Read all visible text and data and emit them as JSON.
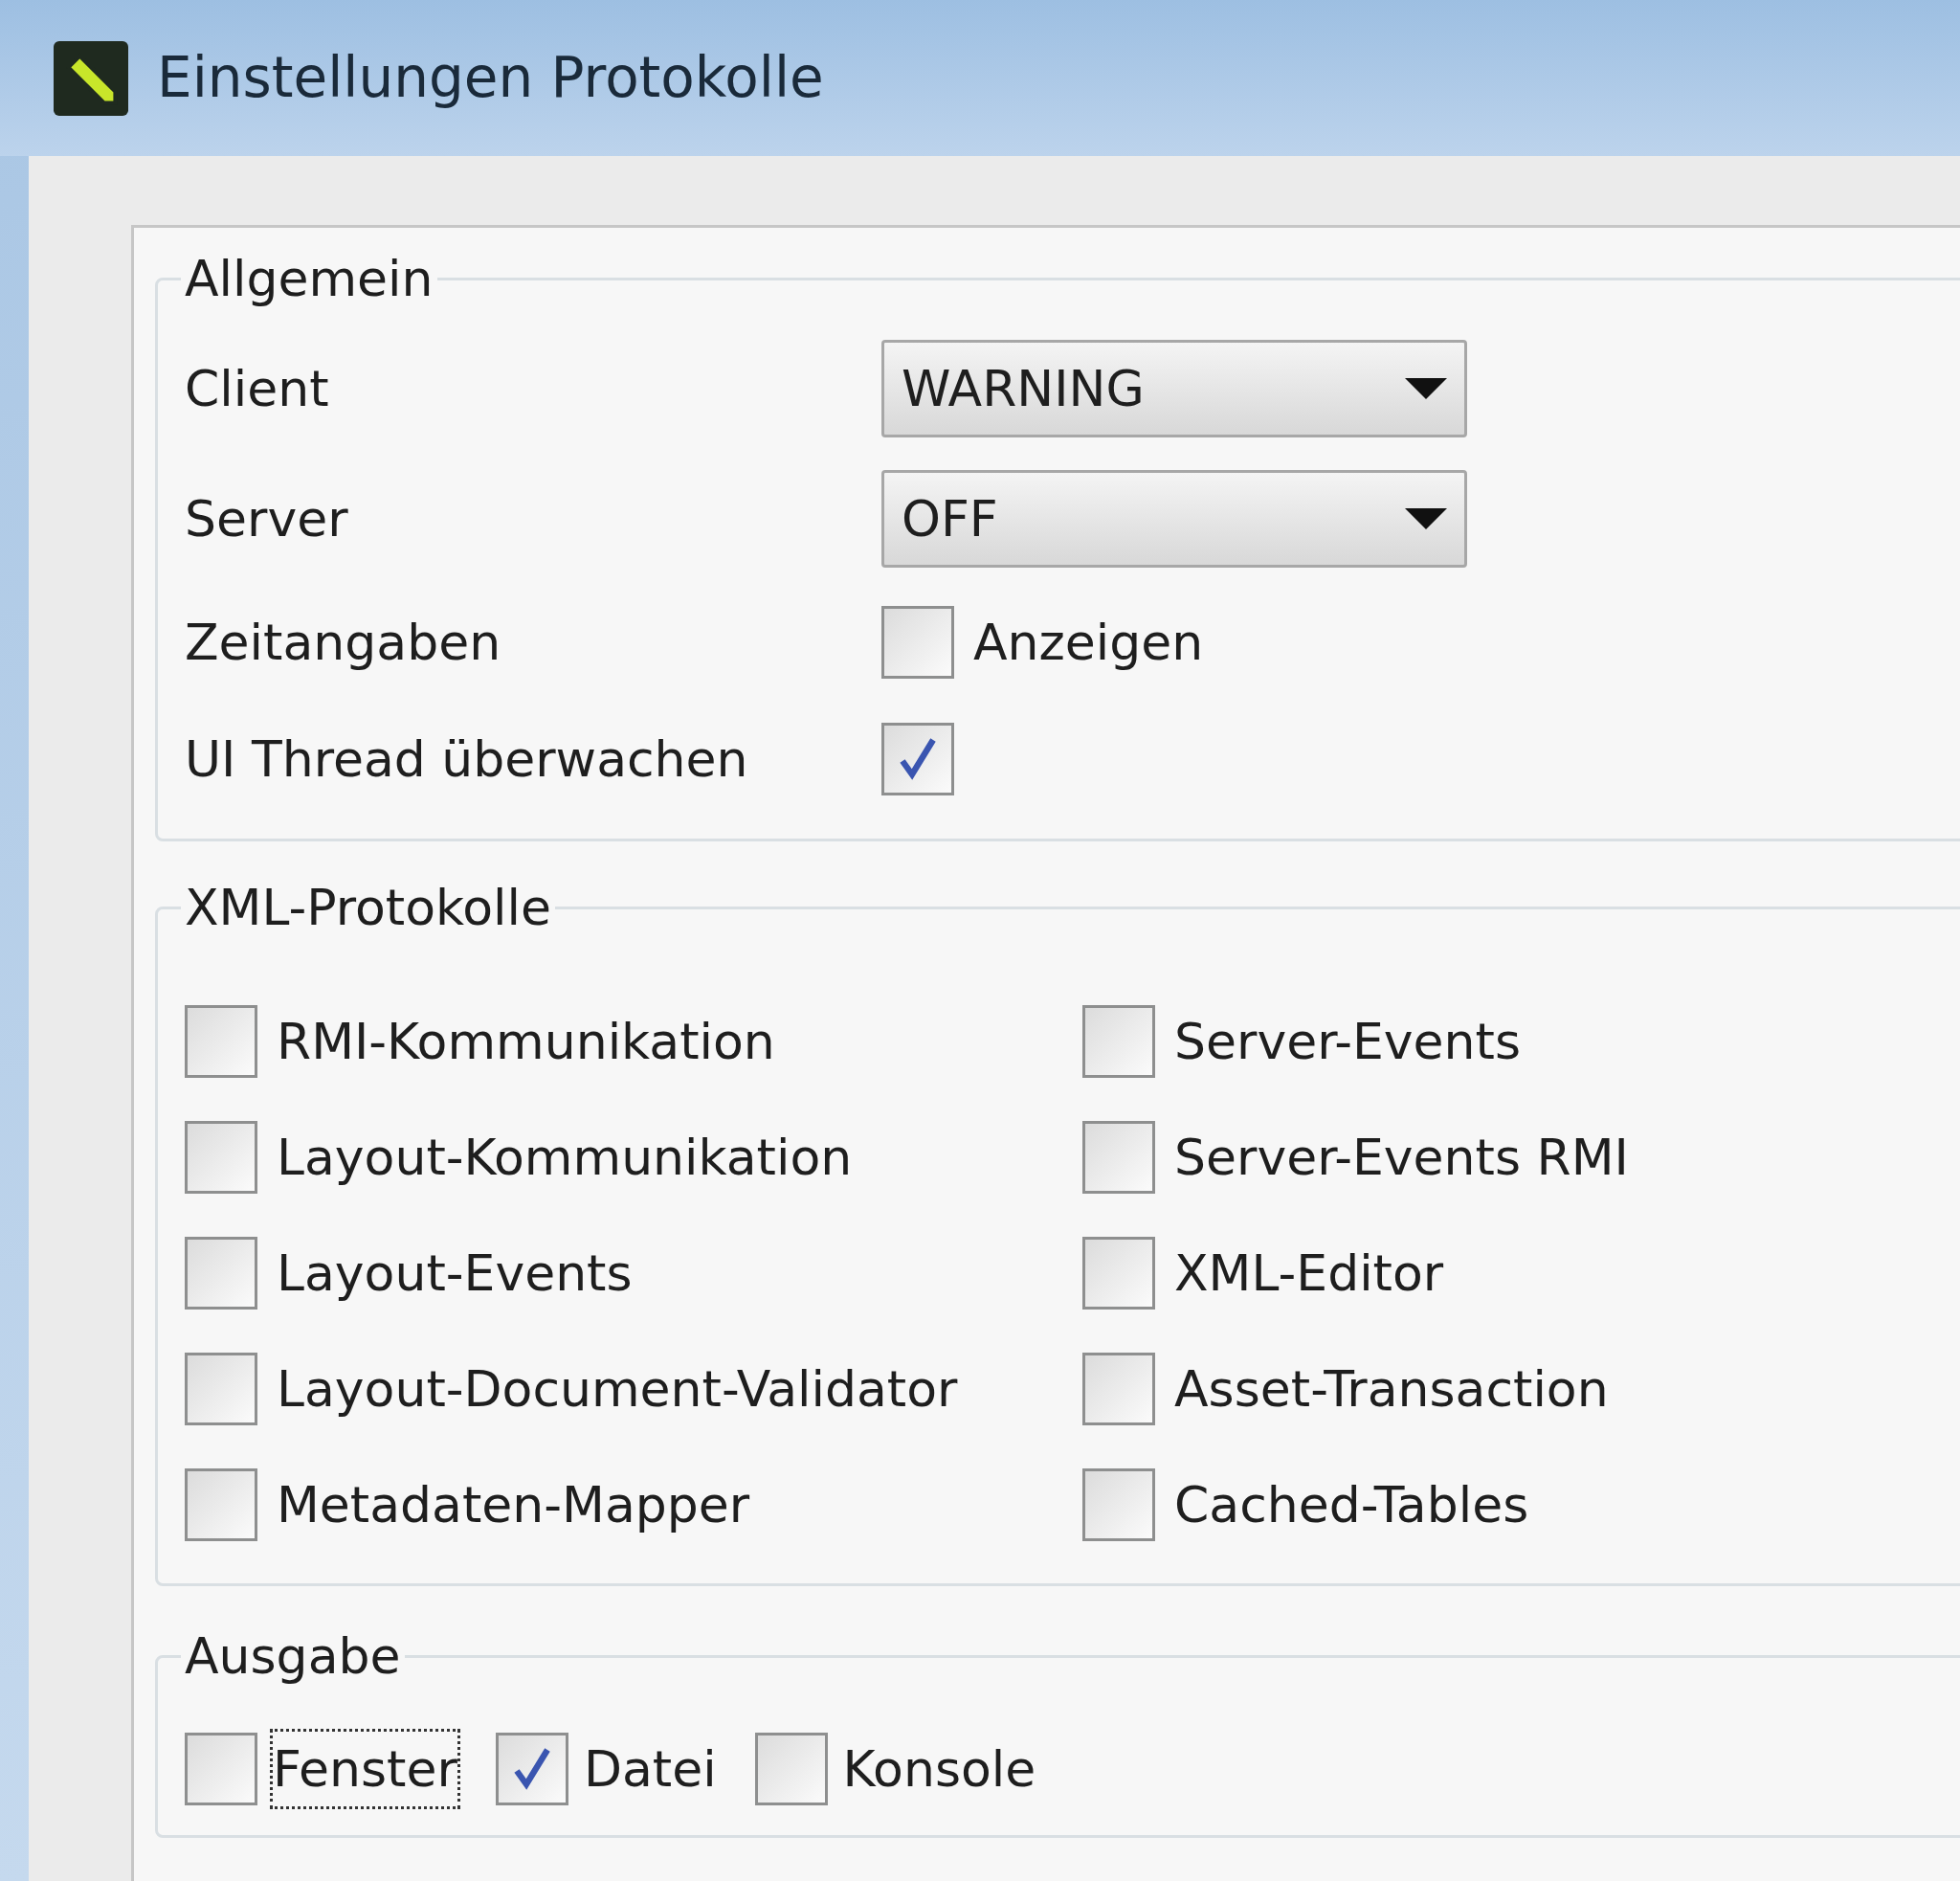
{
  "window": {
    "title": "Einstellungen Protokolle"
  },
  "general": {
    "legend": "Allgemein",
    "rows": [
      {
        "kind": "dropdown",
        "label": "Client",
        "value": "WARNING"
      },
      {
        "kind": "dropdown",
        "label": "Server",
        "value": "OFF"
      },
      {
        "kind": "checkbox",
        "label": "Zeitangaben",
        "option": "Anzeigen",
        "checked": false
      },
      {
        "kind": "checkbox",
        "label": "UI Thread überwachen",
        "checked": true
      }
    ]
  },
  "xml": {
    "legend": "XML-Protokolle",
    "columns": [
      [
        {
          "label": "RMI-Kommunikation",
          "checked": false
        },
        {
          "label": "Layout-Kommunikation",
          "checked": false
        },
        {
          "label": "Layout-Events",
          "checked": false
        },
        {
          "label": "Layout-Document-Validator",
          "checked": false
        },
        {
          "label": "Metadaten-Mapper",
          "checked": false
        }
      ],
      [
        {
          "label": "Server-Events",
          "checked": false
        },
        {
          "label": "Server-Events RMI",
          "checked": false
        },
        {
          "label": "XML-Editor",
          "checked": false
        },
        {
          "label": "Asset-Transaction",
          "checked": false
        },
        {
          "label": "Cached-Tables",
          "checked": false
        }
      ]
    ]
  },
  "output": {
    "legend": "Ausgabe",
    "items": [
      {
        "label": "Fenster",
        "checked": false,
        "focused": true
      },
      {
        "label": "Datei",
        "checked": true,
        "focused": false
      },
      {
        "label": "Konsole",
        "checked": false,
        "focused": false
      }
    ]
  }
}
